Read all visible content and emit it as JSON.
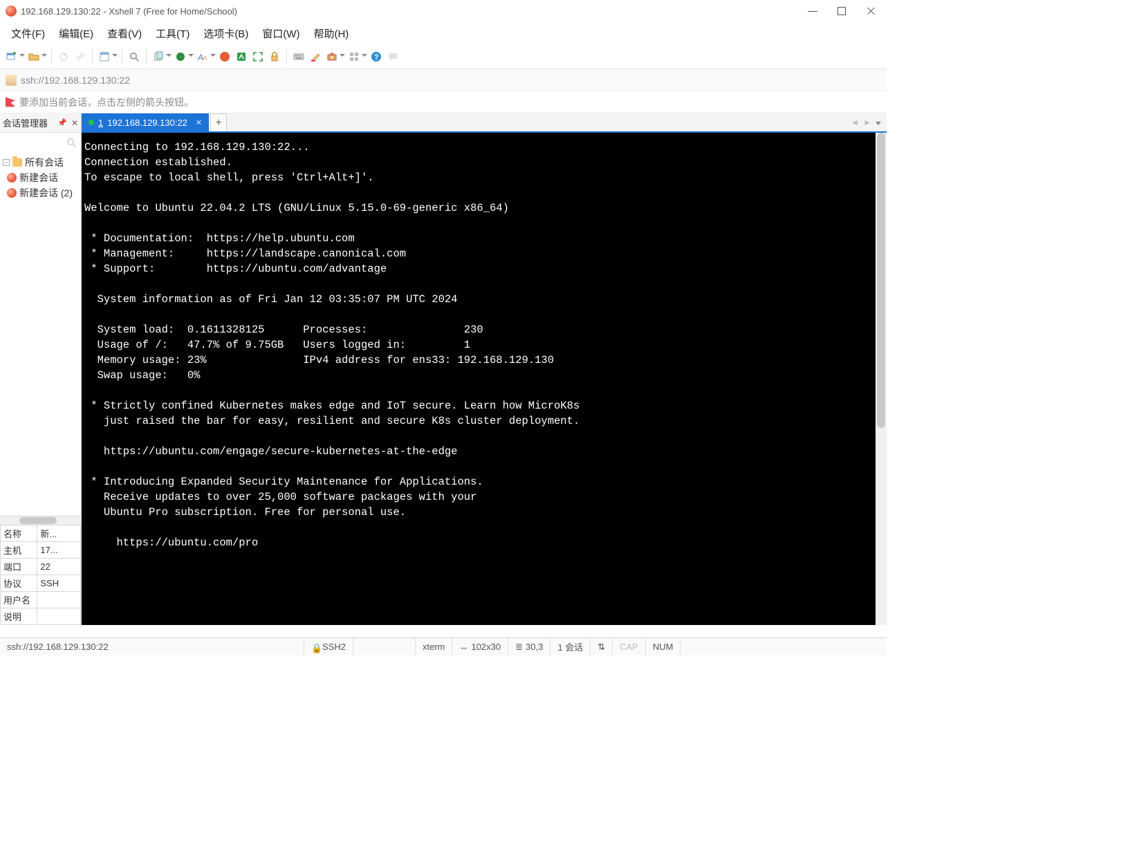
{
  "window": {
    "title": "192.168.129.130:22 - Xshell 7 (Free for Home/School)"
  },
  "menu": {
    "file": "文件(F)",
    "edit": "编辑(E)",
    "view": "查看(V)",
    "tools": "工具(T)",
    "tabs": "选项卡(B)",
    "window": "窗口(W)",
    "help": "帮助(H)"
  },
  "address": {
    "url": "ssh://192.168.129.130:22"
  },
  "hint": {
    "text": "要添加当前会话，点击左侧的箭头按钮。"
  },
  "sidebar": {
    "title": "会话管理器",
    "all_sessions": "所有会话",
    "items": [
      {
        "label": "新建会话"
      },
      {
        "label": "新建会话 (2)"
      }
    ]
  },
  "properties": {
    "rows": [
      {
        "k": "名称",
        "v": "新..."
      },
      {
        "k": "主机",
        "v": "17..."
      },
      {
        "k": "端口",
        "v": "22"
      },
      {
        "k": "协议",
        "v": "SSH"
      },
      {
        "k": "用户名",
        "v": ""
      },
      {
        "k": "说明",
        "v": ""
      }
    ]
  },
  "tab": {
    "index": "1",
    "label": "192.168.129.130:22",
    "add": "+"
  },
  "terminal": {
    "text": "Connecting to 192.168.129.130:22...\nConnection established.\nTo escape to local shell, press 'Ctrl+Alt+]'.\n\nWelcome to Ubuntu 22.04.2 LTS (GNU/Linux 5.15.0-69-generic x86_64)\n\n * Documentation:  https://help.ubuntu.com\n * Management:     https://landscape.canonical.com\n * Support:        https://ubuntu.com/advantage\n\n  System information as of Fri Jan 12 03:35:07 PM UTC 2024\n\n  System load:  0.1611328125      Processes:               230\n  Usage of /:   47.7% of 9.75GB   Users logged in:         1\n  Memory usage: 23%               IPv4 address for ens33: 192.168.129.130\n  Swap usage:   0%\n\n * Strictly confined Kubernetes makes edge and IoT secure. Learn how MicroK8s\n   just raised the bar for easy, resilient and secure K8s cluster deployment.\n\n   https://ubuntu.com/engage/secure-kubernetes-at-the-edge\n\n * Introducing Expanded Security Maintenance for Applications.\n   Receive updates to over 25,000 software packages with your\n   Ubuntu Pro subscription. Free for personal use.\n\n     https://ubuntu.com/pro\n"
  },
  "status": {
    "url": "ssh://192.168.129.130:22",
    "proto": "SSH2",
    "term": "xterm",
    "size": "102x30",
    "cursor": "30,3",
    "sessions": "1 会话",
    "cap": "CAP",
    "num": "NUM",
    "arrows": "⇅",
    "sizearrow": "↔"
  }
}
